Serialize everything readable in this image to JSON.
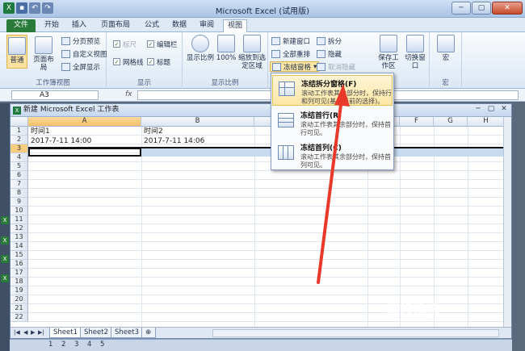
{
  "app": {
    "title": "Microsoft Excel (试用版)"
  },
  "window_controls": {
    "minimize": "─",
    "maximize": "▢",
    "close": "✕"
  },
  "tabs": [
    {
      "label": "文件"
    },
    {
      "label": "开始"
    },
    {
      "label": "插入"
    },
    {
      "label": "页面布局"
    },
    {
      "label": "公式"
    },
    {
      "label": "数据"
    },
    {
      "label": "审阅"
    },
    {
      "label": "视图"
    }
  ],
  "ribbon": {
    "group_workbook_views": {
      "label": "工作簿视图",
      "normal": "普通",
      "page_layout": "页面布局",
      "page_break": "分页预览",
      "custom_views": "自定义视图",
      "full_screen": "全屏显示"
    },
    "group_show": {
      "label": "显示",
      "ruler": "标尺",
      "formula_bar": "编辑栏",
      "gridlines": "网格线",
      "headings": "标题"
    },
    "group_zoom": {
      "label": "显示比例",
      "zoom": "显示比例",
      "hundred": "100%",
      "zoom_selection": "缩放到选定区域"
    },
    "group_window": {
      "new_window": "新建窗口",
      "arrange_all": "全部重排",
      "freeze_panes": "冻结窗格",
      "split": "拆分",
      "hide": "隐藏",
      "unhide": "取消隐藏",
      "save_workspace": "保存工作区",
      "switch_windows": "切换窗口"
    },
    "group_macros": {
      "label": "宏",
      "macros": "宏"
    }
  },
  "formula_bar": {
    "name_box": "A3",
    "fx": "fx",
    "value": ""
  },
  "workbook": {
    "title": "新建 Microsoft Excel 工作表"
  },
  "grid": {
    "columns": [
      "A",
      "B",
      "C",
      "D",
      "E",
      "F",
      "G",
      "H"
    ],
    "rows": [
      "1",
      "2",
      "3",
      "4",
      "5",
      "6",
      "7",
      "8",
      "9",
      "10",
      "11",
      "12",
      "13",
      "14",
      "15",
      "16",
      "17",
      "18",
      "19",
      "20",
      "21",
      "22"
    ],
    "cells": {
      "A1": "时间1",
      "B1": "时间2",
      "A2": "2017-7-11 14:00",
      "B2": "2017-7-11 14:06"
    }
  },
  "sheets": [
    "Sheet1",
    "Sheet2",
    "Sheet3"
  ],
  "taskbar": [
    "1",
    "2",
    "3",
    "4",
    "5"
  ],
  "freeze_menu": [
    {
      "title": "冻结拆分窗格(F)",
      "desc": "滚动工作表其余部分时，保持行和列可见(基于当前的选择)。"
    },
    {
      "title": "冻结首行(R)",
      "desc": "滚动工作表其余部分时，保持首行可见。"
    },
    {
      "title": "冻结首列(C)",
      "desc": "滚动工作表其余部分时，保持首列可见。"
    }
  ],
  "watermark": {
    "text": "搜狗指南",
    "url": "zhinan.sogou.com"
  },
  "colors": {
    "file_tab": "#2a7a3a",
    "arrow": "#e8392b",
    "highlight": "#fde6a6"
  }
}
